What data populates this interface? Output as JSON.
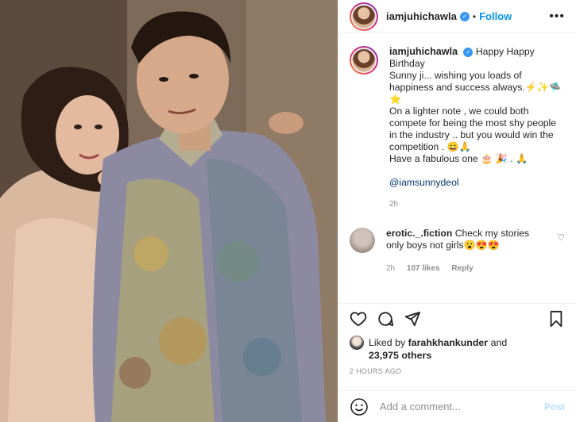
{
  "post": {
    "username": "iamjuhichawla",
    "dot": "•",
    "follow_label": "Follow",
    "more_icon": "more-horizontal-icon"
  },
  "caption": {
    "username": "iamjuhichawla",
    "line1": "Happy Happy Birthday",
    "line2": "Sunny ji... wishing you loads of",
    "line3": "happiness and success always.⚡✨🛸",
    "line4": "⭐",
    "line5": "On a lighter note , we could both",
    "line6": "compete for being the most shy people",
    "line7": "in the industry .. but you would win the",
    "line8": "competition . 😄🙏",
    "line9": "Have a fabulous one 🎂 🎉 . 🙏",
    "mention": "@iamsunnydeol",
    "time": "2h"
  },
  "comment": {
    "username": "erotic._.fiction",
    "text_line1": "Check my stories",
    "text_line2": "only boys not girls😮😍😍",
    "time": "2h",
    "likes": "107 likes",
    "reply": "Reply"
  },
  "likes": {
    "prefix": "Liked by ",
    "user": "farahkhankunder",
    "conj": " and",
    "count": "23,975 others"
  },
  "timestamp": "2 HOURS AGO",
  "add_comment": {
    "placeholder": "Add a comment...",
    "post_label": "Post"
  }
}
